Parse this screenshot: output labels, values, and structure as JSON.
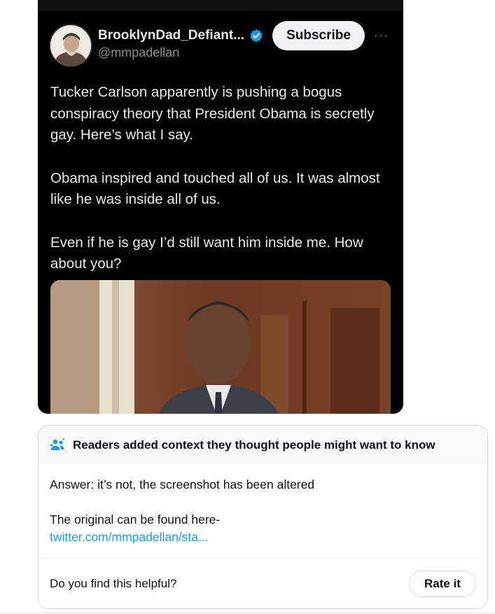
{
  "tweet": {
    "display_name": "BrooklynDad_Defiant...",
    "handle": "@mmpadellan",
    "subscribe_label": "Subscribe",
    "more_label": "···",
    "paragraphs": [
      "Tucker Carlson apparently is pushing a bogus conspiracy theory that President Obama is secretly gay. Here’s what I say.",
      "Obama inspired and touched all of us. It was almost like he was inside all of us.",
      "Even if he is gay I’d still want him inside me. How about you?"
    ],
    "icons": {
      "verified": "verified-badge-icon",
      "more": "more-options-icon"
    }
  },
  "note": {
    "title": "Readers added context they thought people might want to know",
    "answer": "Answer: it’s not, the screenshot has been altered",
    "original_intro": "The original can be found here-",
    "link_text": "twitter.com/mmpadellan/sta...",
    "helpful_question": "Do you find this helpful?",
    "rate_label": "Rate it",
    "icons": {
      "header": "people-icon"
    }
  },
  "colors": {
    "accent": "#1d9bf0",
    "tweet_background": "#000000",
    "note_header_bg": "#f7f9f9"
  }
}
